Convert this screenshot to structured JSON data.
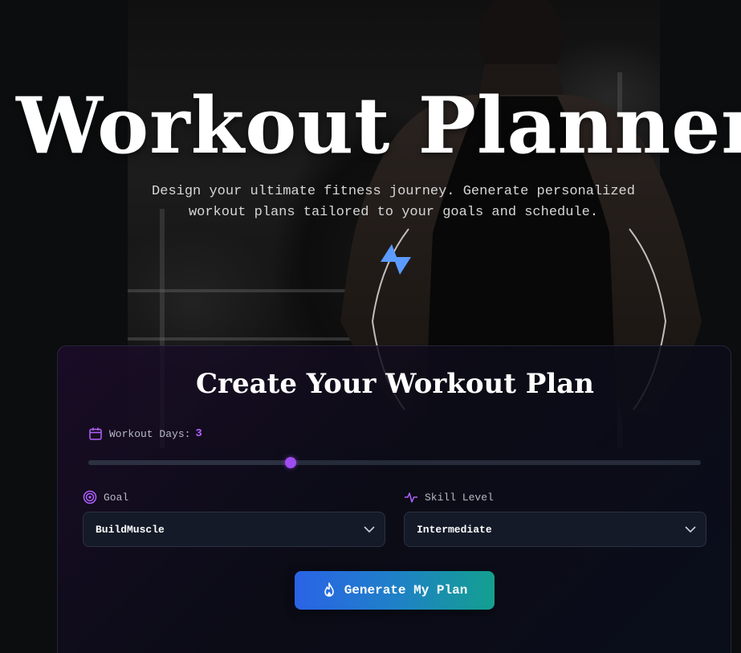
{
  "hero": {
    "title": "Workout Planner",
    "subtitle": "Design your ultimate fitness journey. Generate personalized workout plans tailored to your goals and schedule.",
    "icon": "lightning-bolt-icon",
    "accent_color": "#5b9bff"
  },
  "form": {
    "title": "Create Your Workout Plan",
    "workout_days": {
      "label": "Workout Days:",
      "value": "3",
      "icon": "calendar-icon",
      "slider_fraction": 0.33
    },
    "goal": {
      "label": "Goal",
      "icon": "target-icon",
      "selected": "BuildMuscle"
    },
    "skill_level": {
      "label": "Skill Level",
      "icon": "activity-pulse-icon",
      "selected": "Intermediate"
    },
    "generate_button": {
      "label": "Generate My Plan",
      "icon": "flame-icon"
    },
    "accent_color": "#a855f7"
  }
}
